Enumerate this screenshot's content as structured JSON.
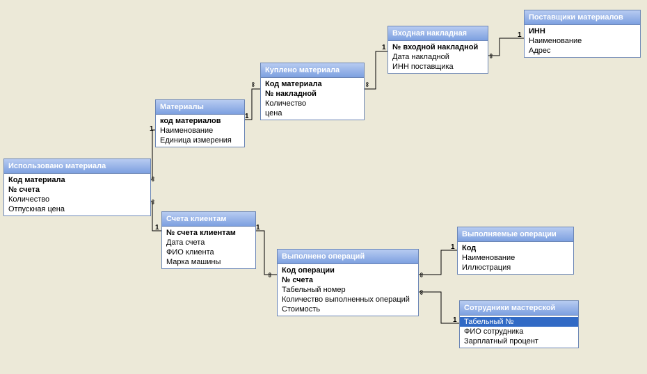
{
  "entities": [
    {
      "id": "ispolzovano_materiala",
      "title": "Использовано материала",
      "fields": [
        {
          "name": "Код материала",
          "key": true
        },
        {
          "name": "№ счета",
          "key": true
        },
        {
          "name": "Количество"
        },
        {
          "name": "Отпускная цена"
        }
      ]
    },
    {
      "id": "materialy",
      "title": "Материалы",
      "fields": [
        {
          "name": "код материалов",
          "key": true
        },
        {
          "name": "Наименование"
        },
        {
          "name": "Единица измерения"
        }
      ]
    },
    {
      "id": "kupleno_materiala",
      "title": "Куплено материала",
      "fields": [
        {
          "name": "Код материала",
          "key": true
        },
        {
          "name": "№ накладной",
          "key": true
        },
        {
          "name": "Количество"
        },
        {
          "name": "цена"
        }
      ]
    },
    {
      "id": "vhodnaya_nakladnaya",
      "title": "Входная накладная",
      "fields": [
        {
          "name": "№ входной накладной",
          "key": true
        },
        {
          "name": "Дата накладной"
        },
        {
          "name": "ИНН поставщика"
        }
      ]
    },
    {
      "id": "postavshiki_materialov",
      "title": "Поставщики материалов",
      "fields": [
        {
          "name": "ИНН",
          "key": true
        },
        {
          "name": "Наименование"
        },
        {
          "name": "Адрес"
        }
      ]
    },
    {
      "id": "scheta_klientam",
      "title": "Счета клиентам",
      "fields": [
        {
          "name": "№ счета клиентам",
          "key": true
        },
        {
          "name": "Дата счета"
        },
        {
          "name": "ФИО клиента"
        },
        {
          "name": "Марка машины"
        }
      ]
    },
    {
      "id": "vypolneno_operaciy",
      "title": "Выполнено операций",
      "fields": [
        {
          "name": "Код операции",
          "key": true
        },
        {
          "name": "№ счета",
          "key": true
        },
        {
          "name": "Табельный номер"
        },
        {
          "name": "Количество выполненных операций"
        },
        {
          "name": "Стоимость"
        }
      ]
    },
    {
      "id": "vypolnyaemye_operacii",
      "title": "Выполняемые операции",
      "fields": [
        {
          "name": "Код",
          "key": true
        },
        {
          "name": "Наименование"
        },
        {
          "name": "Иллюстрация"
        }
      ]
    },
    {
      "id": "sotrudniki_masterskoy",
      "title": "Сотрудники мастерской",
      "fields": [
        {
          "name": "Табельный №",
          "key": true,
          "selected": true
        },
        {
          "name": "ФИО сотрудника"
        },
        {
          "name": "Зарплатный процент"
        }
      ]
    }
  ],
  "relationships": [
    {
      "from": "ispolzovano_materiala",
      "to": "materialy",
      "from_label": "∞",
      "to_label": "1"
    },
    {
      "from": "materialy",
      "to": "kupleno_materiala",
      "from_label": "1",
      "to_label": "∞"
    },
    {
      "from": "kupleno_materiala",
      "to": "vhodnaya_nakladnaya",
      "from_label": "∞",
      "to_label": "1"
    },
    {
      "from": "vhodnaya_nakladnaya",
      "to": "postavshiki_materialov",
      "from_label": "∞",
      "to_label": "1"
    },
    {
      "from": "ispolzovano_materiala",
      "to": "scheta_klientam",
      "from_label": "∞",
      "to_label": "1"
    },
    {
      "from": "scheta_klientam",
      "to": "vypolneno_operaciy",
      "from_label": "1",
      "to_label": "∞"
    },
    {
      "from": "vypolneno_operaciy",
      "to": "vypolnyaemye_operacii",
      "from_label": "∞",
      "to_label": "1"
    },
    {
      "from": "vypolneno_operaciy",
      "to": "sotrudniki_masterskoy",
      "from_label": "∞",
      "to_label": "1"
    }
  ]
}
